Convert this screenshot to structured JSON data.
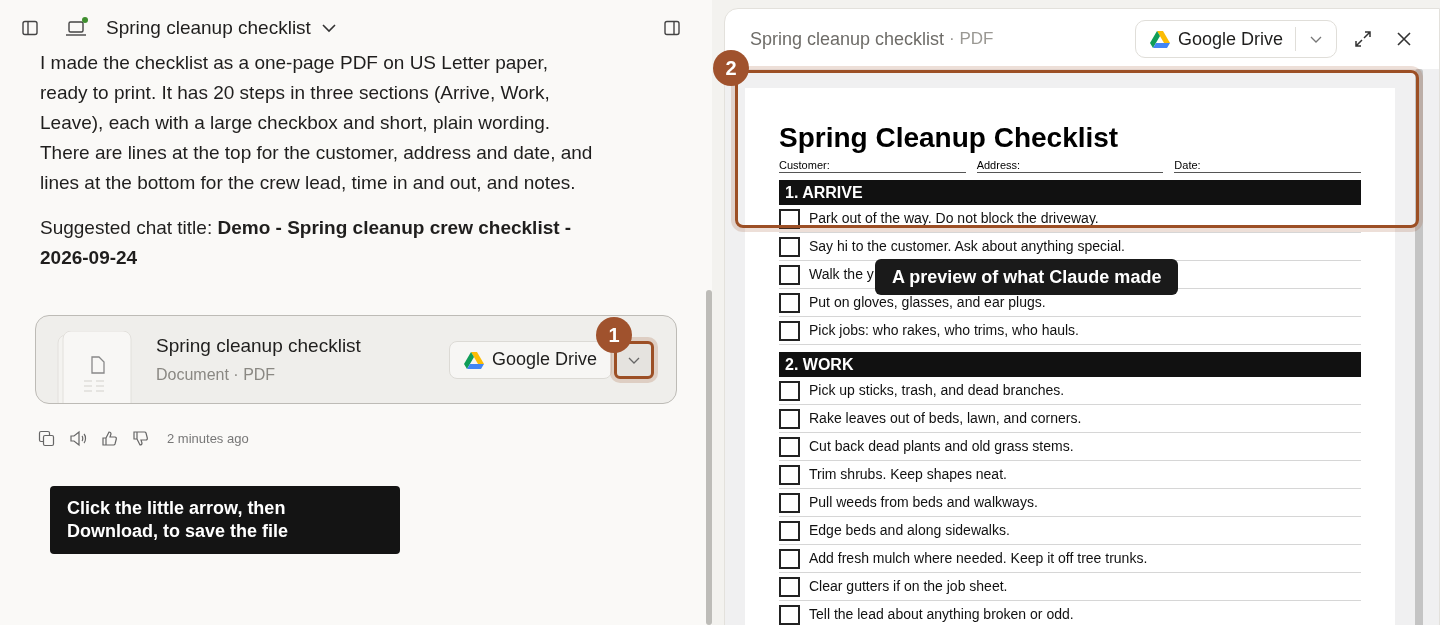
{
  "header": {
    "title": "Spring cleanup checklist"
  },
  "message": {
    "paragraph": "I made the checklist as a one-page PDF on US Letter paper, ready to print. It has 20 steps in three sections (Arrive, Work, Leave), each with a large checkbox and short, plain wording. There are lines at the top for the customer, address and date, and lines at the bottom for the crew lead, time in and out, and notes.",
    "suggested": "Suggested chat title: **Demo - Spring cleanup crew checklist - 2026-09-24**"
  },
  "attachment": {
    "title": "Spring cleanup checklist",
    "subtitle": "Document · PDF",
    "save_button": "Google Drive"
  },
  "meta": {
    "time": "2 minutes ago"
  },
  "preview": {
    "title": "Spring cleanup checklist",
    "format": "· PDF",
    "save_button": "Google Drive"
  },
  "document": {
    "title": "Spring Cleanup Checklist",
    "fields": [
      "Customer:",
      "Address:",
      "Date:"
    ],
    "sections": [
      {
        "heading": "1. ARRIVE",
        "items": [
          {
            "text": "Park out of the way. Do not block the driveway.",
            "checked": false
          },
          {
            "text": "Say hi to the customer. Ask about anything special.",
            "checked": false
          },
          {
            "text": "Walk the y",
            "checked": false
          },
          {
            "text": "Put on gloves, glasses, and ear plugs.",
            "checked": false
          },
          {
            "text": "Pick jobs: who rakes, who trims, who hauls.",
            "checked": false
          }
        ]
      },
      {
        "heading": "2. WORK",
        "items": [
          {
            "text": "Pick up sticks, trash, and dead branches.",
            "checked": false
          },
          {
            "text": "Rake leaves out of beds, lawn, and corners.",
            "checked": false
          },
          {
            "text": "Cut back dead plants and old grass stems.",
            "checked": false
          },
          {
            "text": "Trim shrubs. Keep shapes neat.",
            "checked": false
          },
          {
            "text": "Pull weeds from beds and walkways.",
            "checked": false
          },
          {
            "text": "Edge beds and along sidewalks.",
            "checked": false
          },
          {
            "text": "Add fresh mulch where needed. Keep it off tree trunks.",
            "checked": false
          },
          {
            "text": "Clear gutters if on the job sheet.",
            "checked": false
          },
          {
            "text": "Tell the lead about anything broken or odd.",
            "checked": false
          }
        ]
      }
    ]
  },
  "annotations": [
    {
      "number": "1",
      "text": "Click the little arrow, then Download, to save the file"
    },
    {
      "number": "2",
      "text": "A preview of what Claude made"
    }
  ]
}
